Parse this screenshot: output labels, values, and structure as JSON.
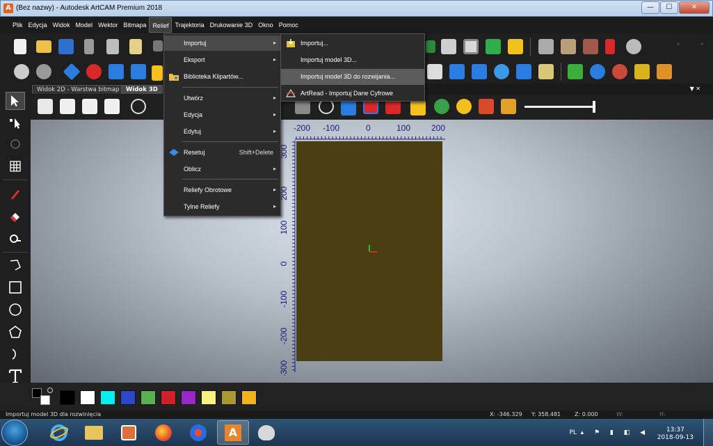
{
  "window": {
    "title": "(Bez nazwy) - Autodesk ArtCAM Premium 2018",
    "app_icon_letter": "A",
    "buttons": {
      "minimize": "—",
      "maximize": "☐",
      "close": "✕"
    }
  },
  "menubar": {
    "items": [
      "Plik",
      "Edycja",
      "Widok",
      "Model",
      "Wektor",
      "Bitmapa",
      "Relief",
      "Trajektoria",
      "Drukowanie 3D",
      "Okno",
      "Pomoc"
    ],
    "active": "Relief"
  },
  "tabs": [
    "Widok 2D - Warstwa bitmap",
    "Widok 3D"
  ],
  "active_tab": "Widok 3D",
  "relief_menu": {
    "items": [
      {
        "label": "Importuj",
        "submenu": true
      },
      {
        "label": "Eksport",
        "submenu": true
      },
      {
        "label": "Biblioteka Klipartów...",
        "icon": "folder-clip-icon"
      },
      {
        "label": "Utwórz",
        "submenu": true
      },
      {
        "label": "Edycja",
        "submenu": true
      },
      {
        "label": "Edytuj",
        "submenu": true
      },
      {
        "label": "Resetuj",
        "shortcut": "Shift+Delete",
        "icon": "reset-relief-icon"
      },
      {
        "label": "Oblicz",
        "submenu": true
      },
      {
        "label": "Reliefy Obrotowe",
        "submenu": true
      },
      {
        "label": "Tylne Reliefy",
        "submenu": true
      }
    ],
    "arrow": "▸"
  },
  "import_submenu": {
    "items": [
      {
        "label": "Importuj..."
      },
      {
        "label": "Importuj model 3D..."
      },
      {
        "label": "Importuj model 3D do rozwijania..."
      },
      {
        "label": "ArtRead - Importuj Dane Cyfrowe"
      }
    ],
    "highlighted": 2
  },
  "rulers": {
    "top": [
      "-200",
      "-100",
      "0",
      "100",
      "200"
    ],
    "left": [
      "300",
      "200",
      "100",
      "0",
      "-100",
      "-200",
      "-300"
    ]
  },
  "palette": {
    "colors": [
      "#000000",
      "#ffffff",
      "#00f0f0",
      "#2e46c8",
      "#58b050",
      "#d0202a",
      "#9a28c8",
      "#f8f080",
      "#a89a30",
      "#f0b41a"
    ]
  },
  "statusbar": {
    "message": "Importuj model 3D dla rozwinięcia",
    "x": "X: -346.329",
    "y": "Y: 358.481",
    "z": "Z: 0.000",
    "w": "W:",
    "h": "H:"
  },
  "taskbar": {
    "lang": "PL",
    "time": "13:37",
    "date": "2018-09-13"
  }
}
